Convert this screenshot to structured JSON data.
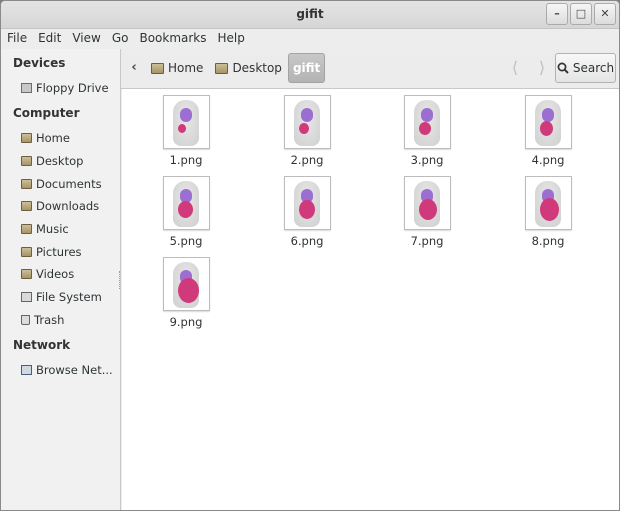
{
  "window": {
    "title": "gifit",
    "controls": [
      "minimize",
      "maximize",
      "close"
    ]
  },
  "menubar": [
    "File",
    "Edit",
    "View",
    "Go",
    "Bookmarks",
    "Help"
  ],
  "breadcrumb": {
    "back": "‹",
    "items": [
      "Home",
      "Desktop",
      "gifit"
    ],
    "active": "gifit"
  },
  "search": {
    "label": "Search"
  },
  "sidebar": {
    "sections": [
      {
        "title": "Devices",
        "items": [
          {
            "label": "Floppy Drive",
            "icon": "floppy-drive-icon"
          }
        ]
      },
      {
        "title": "Computer",
        "items": [
          {
            "label": "Home",
            "icon": "folder-icon"
          },
          {
            "label": "Desktop",
            "icon": "folder-icon"
          },
          {
            "label": "Documents",
            "icon": "folder-icon"
          },
          {
            "label": "Downloads",
            "icon": "folder-icon"
          },
          {
            "label": "Music",
            "icon": "folder-icon"
          },
          {
            "label": "Pictures",
            "icon": "folder-icon"
          },
          {
            "label": "Videos",
            "icon": "folder-icon"
          },
          {
            "label": "File System",
            "icon": "drive-icon"
          },
          {
            "label": "Trash",
            "icon": "trash-icon"
          }
        ]
      },
      {
        "title": "Network",
        "items": [
          {
            "label": "Browse Net...",
            "icon": "network-icon"
          }
        ]
      }
    ]
  },
  "files": [
    {
      "name": "1.png"
    },
    {
      "name": "2.png"
    },
    {
      "name": "3.png"
    },
    {
      "name": "4.png"
    },
    {
      "name": "5.png"
    },
    {
      "name": "6.png"
    },
    {
      "name": "7.png"
    },
    {
      "name": "8.png"
    },
    {
      "name": "9.png"
    }
  ],
  "colors": {
    "accent_womb": "#d13a7a",
    "organ": "#9d6ed1",
    "active_crumb": "#b3b3b3"
  }
}
